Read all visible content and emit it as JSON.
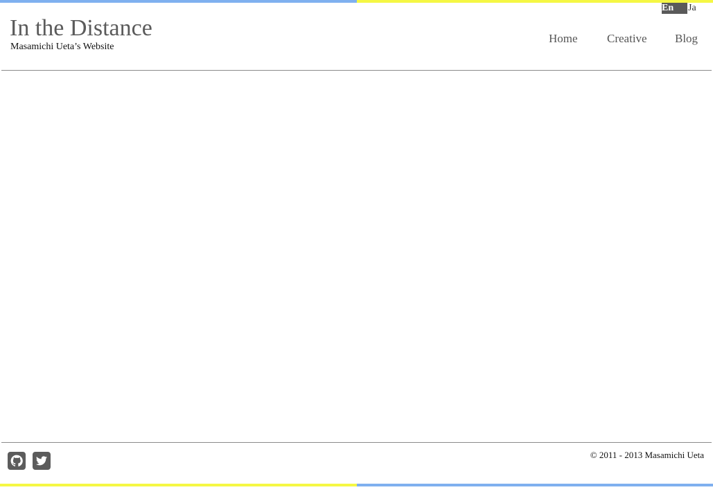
{
  "header": {
    "title": "In the Distance",
    "subtitle": "Masamichi Ueta’s Website"
  },
  "language": {
    "items": [
      {
        "label": "En",
        "active": true
      },
      {
        "label": "Ja",
        "active": false
      }
    ]
  },
  "nav": {
    "items": [
      {
        "label": "Home"
      },
      {
        "label": "Creative"
      },
      {
        "label": "Blog"
      }
    ]
  },
  "footer": {
    "copyright": "© 2011 - 2013 Masamichi Ueta",
    "social": [
      {
        "icon": "github-icon"
      },
      {
        "icon": "twitter-icon"
      }
    ]
  },
  "colors": {
    "accent_blue": "#7fb0ef",
    "accent_yellow": "#f5f744",
    "title_gray": "#5b5b5b",
    "active_lang_bg": "#5a5a5a",
    "icon_gray": "#5c5c5c",
    "rule_gray": "#8a8a8a"
  }
}
